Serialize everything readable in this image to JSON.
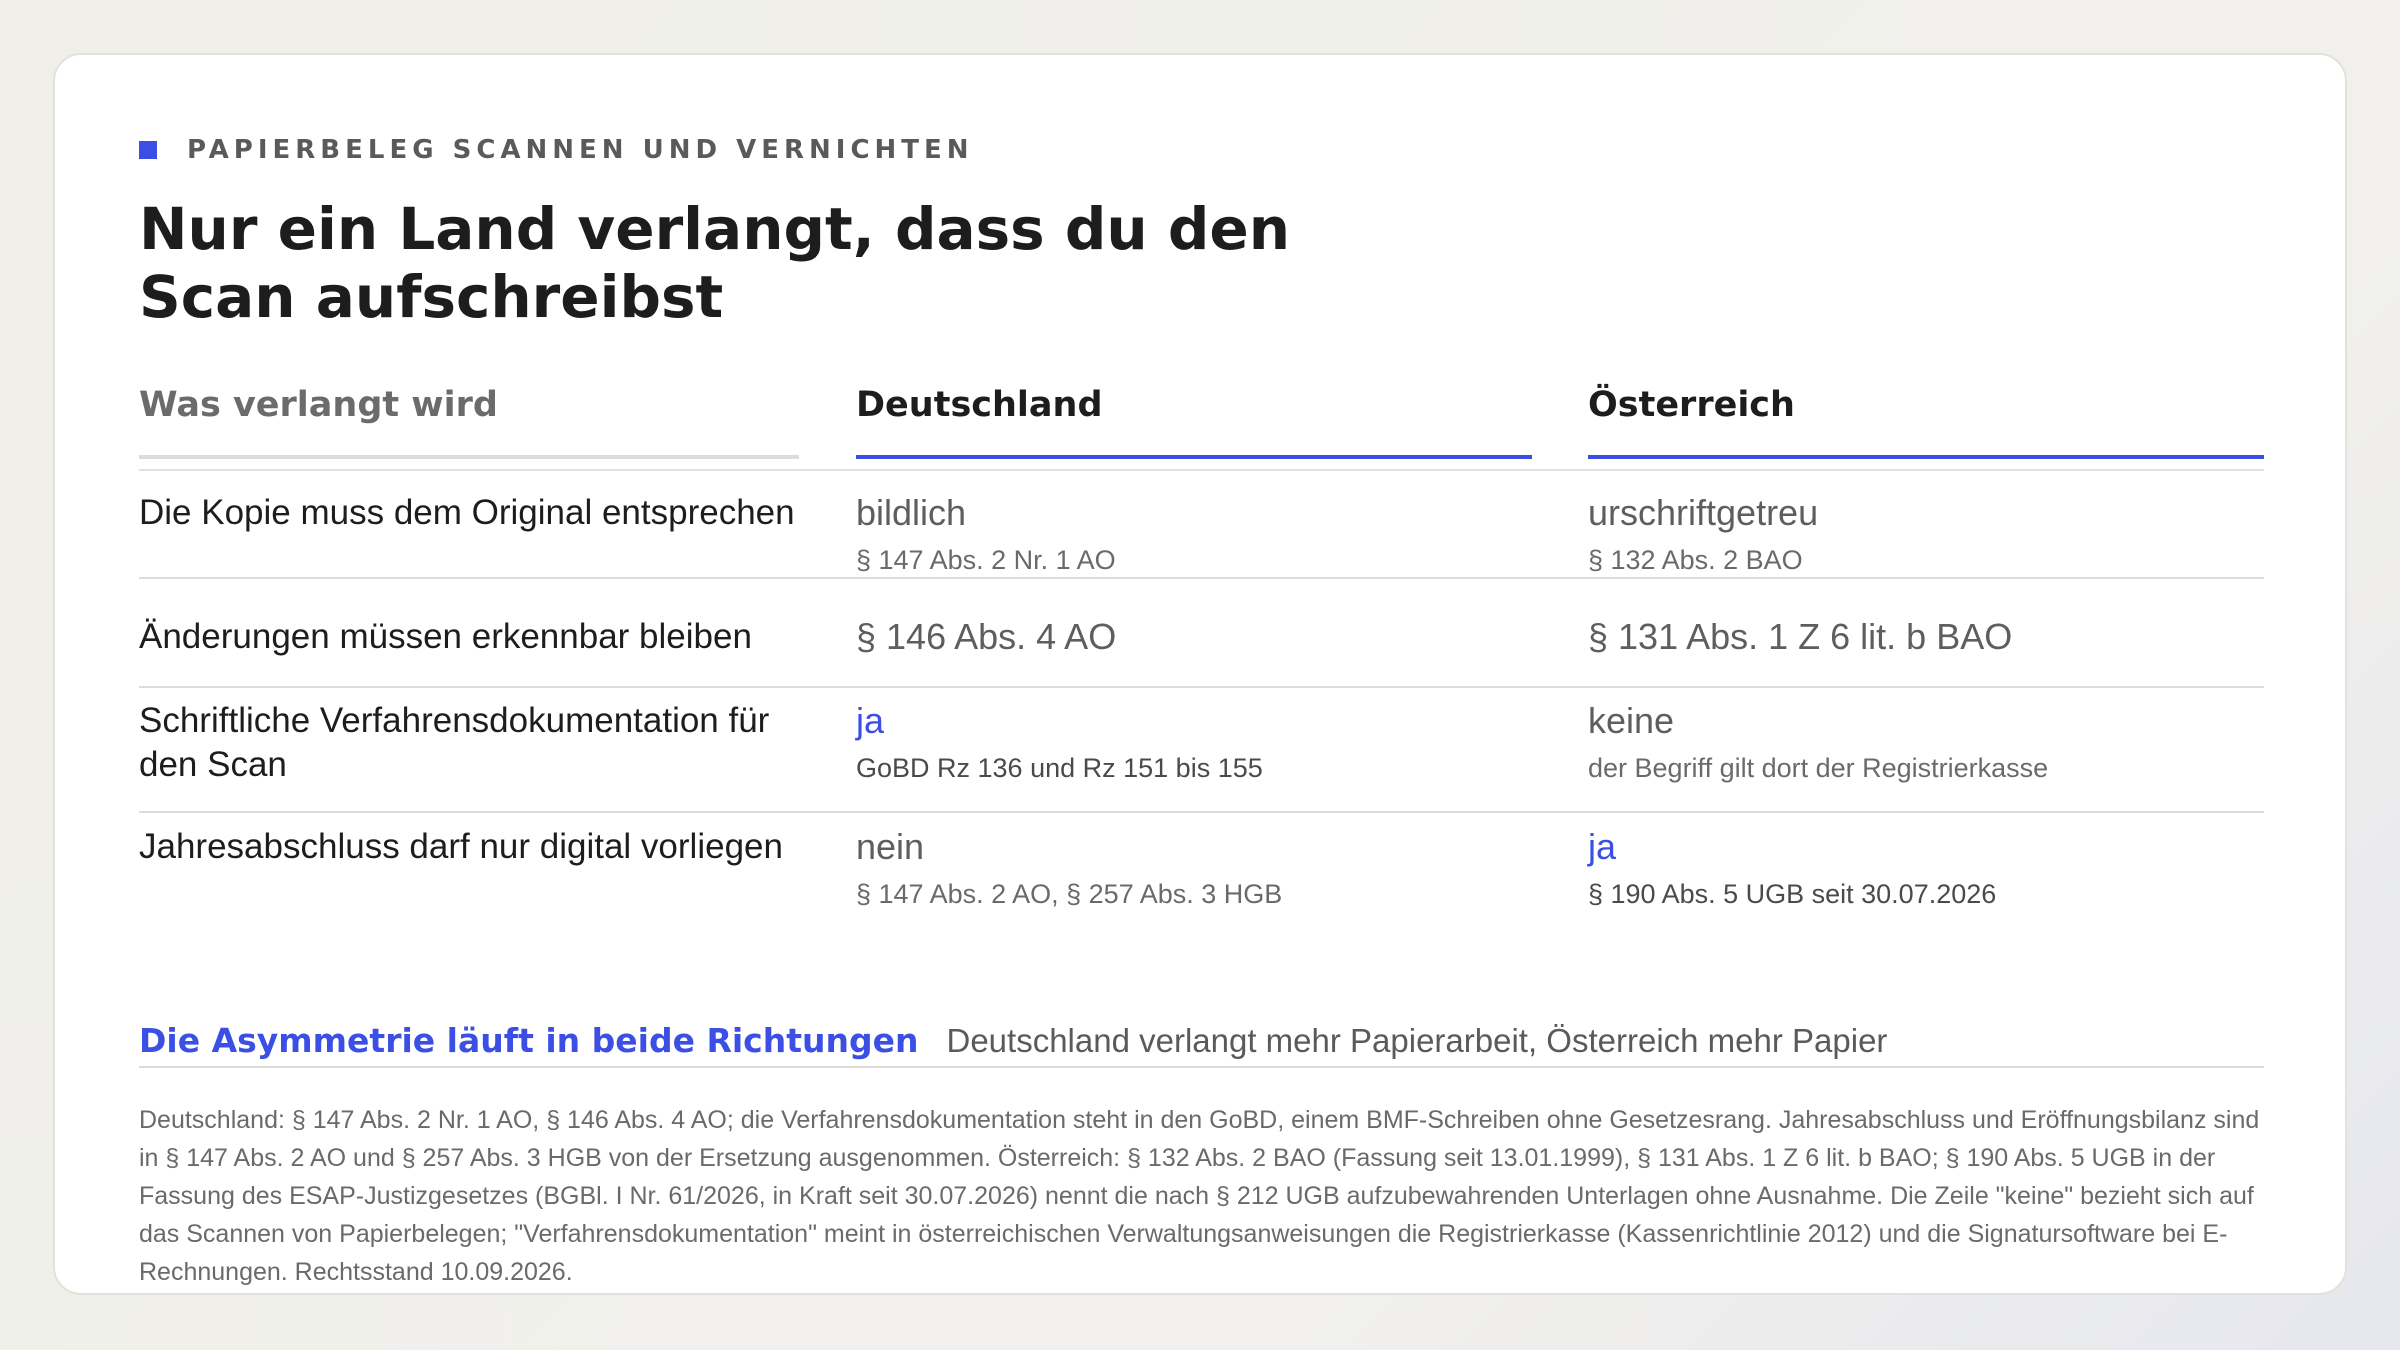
{
  "eyebrow": "PAPIERBELEG SCANNEN UND VERNICHTEN",
  "title": "Nur ein Land verlangt, dass du den Scan aufschreibst",
  "columns": [
    "Was verlangt wird",
    "Deutschland",
    "Österreich"
  ],
  "rows": [
    {
      "label": "Die Kopie muss dem Original entsprechen",
      "de_value": "bildlich",
      "de_ref": "§ 147 Abs. 2 Nr. 1 AO",
      "at_value": "urschriftgetreu",
      "at_ref": "§ 132 Abs. 2 BAO"
    },
    {
      "label": "Änderungen müssen erkennbar bleiben",
      "de_value": "§ 146 Abs. 4 AO",
      "de_ref": "",
      "at_value": "§ 131 Abs. 1 Z 6 lit. b BAO",
      "at_ref": ""
    },
    {
      "label": "Schriftliche Verfahrensdokumentation für den Scan",
      "de_value": "ja",
      "de_ref": "GoBD Rz 136 und Rz 151 bis 155",
      "at_value": "keine",
      "at_ref": "der Begriff gilt dort der Registrierkasse"
    },
    {
      "label": "Jahresabschluss darf nur digital vorliegen",
      "de_value": "nein",
      "de_ref": "§ 147 Abs. 2 AO, § 257 Abs. 3 HGB",
      "at_value": "ja",
      "at_ref": "§ 190 Abs. 5 UGB seit 30.07.2026"
    }
  ],
  "callout": {
    "lead": "Die Asymmetrie läuft in beide Richtungen",
    "text": "Deutschland verlangt mehr Papierarbeit, Österreich mehr Papier"
  },
  "footnote": "Deutschland: § 147 Abs. 2 Nr. 1 AO, § 146 Abs. 4 AO; die Verfahrensdokumentation steht in den GoBD, einem BMF-Schreiben ohne Gesetzesrang. Jahresabschluss und Eröffnungsbilanz sind in § 147 Abs. 2 AO und § 257 Abs. 3 HGB von der Ersetzung ausgenommen. Österreich: § 132 Abs. 2 BAO (Fassung seit 13.01.1999), § 131 Abs. 1 Z 6 lit. b BAO; § 190 Abs. 5 UGB in der Fassung des ESAP-Justizgesetzes (BGBl. I Nr. 61/2026, in Kraft seit 30.07.2026) nennt die nach § 212 UGB aufzubewahrenden Unterlagen ohne Ausnahme. Die Zeile \"keine\" bezieht sich auf das Scannen von Papierbelegen; \"Verfahrensdokumentation\" meint in österreichischen Verwaltungsanweisungen die Registrierkasse (Kassenrichtlinie 2012) und die Signatursoftware bei E-Rechnungen. Rechtsstand 10.09.2026.",
  "colors": {
    "accent": "#3b4fe4"
  }
}
